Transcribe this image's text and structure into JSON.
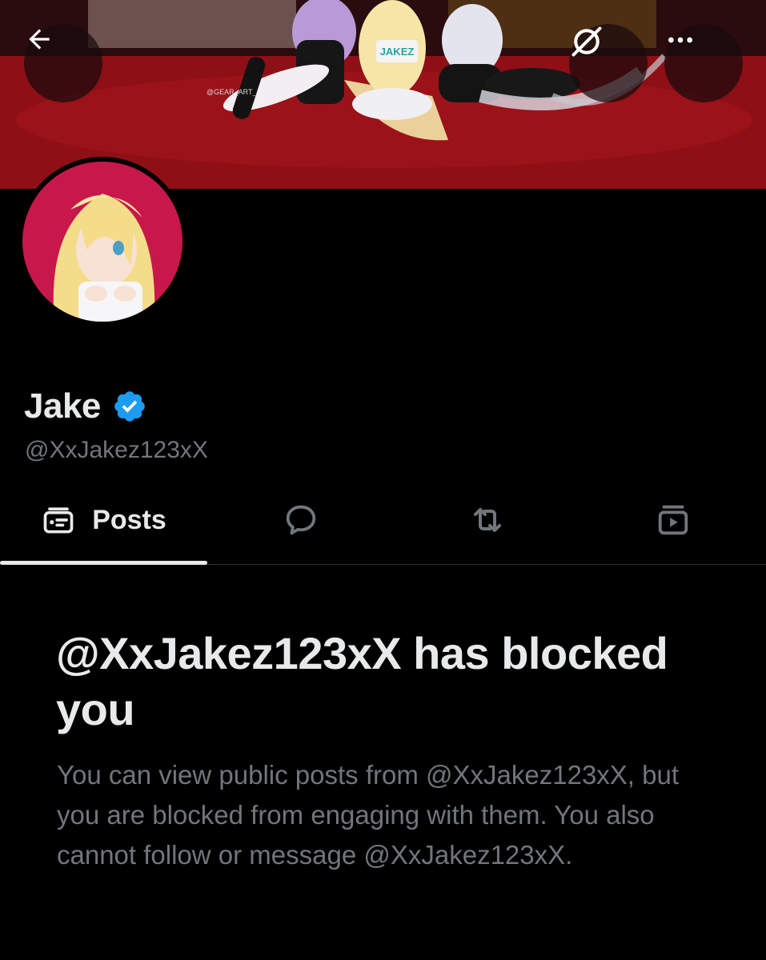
{
  "banner": {
    "watermark": "@GEAR_ART_",
    "sign_text": "JAKEZ"
  },
  "header": {
    "back_icon": "arrow-left-icon",
    "grok_icon": "grok-icon",
    "more_icon": "more-horizontal-icon"
  },
  "profile": {
    "display_name": "Jake",
    "handle": "@XxJakez123xX",
    "verified_color": "#1d9bf0"
  },
  "tabs": [
    {
      "label": "Posts",
      "icon": "posts-icon",
      "selected": true
    },
    {
      "label": "",
      "icon": "replies-icon",
      "selected": false
    },
    {
      "label": "",
      "icon": "repost-icon",
      "selected": false
    },
    {
      "label": "",
      "icon": "media-icon",
      "selected": false
    }
  ],
  "blocked": {
    "title": "@XxJakez123xX has blocked you",
    "body": "You can view public posts from @XxJakez123xX, but you are blocked from engaging with them. You also cannot follow or message @XxJakez123xX."
  }
}
